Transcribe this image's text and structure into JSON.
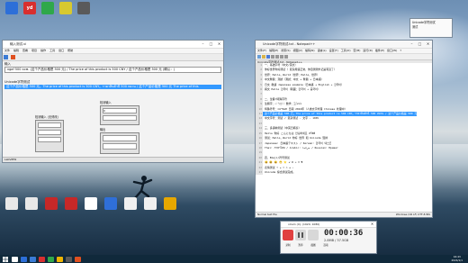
{
  "desktop": {
    "icons_top": [
      {
        "label": "",
        "color": "#2d6fd8"
      },
      {
        "label": "yd",
        "color": "#d82f2f"
      },
      {
        "label": "",
        "color": "#2fa84a"
      },
      {
        "label": "",
        "color": "#d8c92f"
      },
      {
        "label": "",
        "color": "#5a5a5a"
      }
    ],
    "icons_bottom": [
      {
        "label": "",
        "color": "#e8e8e8"
      },
      {
        "label": "",
        "color": "#e8e8e8"
      },
      {
        "label": "",
        "color": "#c62828"
      },
      {
        "label": "",
        "color": "#c62828"
      },
      {
        "label": "",
        "color": "#ffffff"
      },
      {
        "label": "",
        "color": "#2f6fd8"
      },
      {
        "label": "",
        "color": "#f0f0f0"
      },
      {
        "label": "",
        "color": "#f0f0f0"
      },
      {
        "label": "",
        "color": "#e6a700"
      }
    ],
    "notification": {
      "text": "Unicode字符测试\n测试"
    }
  },
  "win_left": {
    "title": "输入测试.vi",
    "menu": [
      "文件",
      "编辑",
      "查看",
      "项目",
      "操作",
      "工具",
      "窗口",
      "帮助"
    ],
    "line1": "输入",
    "line2": "xgaf 500 ксм. (这个产品价格是 500 元) / The price of this product is 500 CNY / 这个产品价格是 500 元 (确认：)",
    "label_unicode": "Unicode字符测试",
    "line3": "这个产品价格是 500 元。The price of this product is 500 CNY。ราคาสินค้านี้ 500 หยวน / 这个产品价格是 500 元 The price of this",
    "label_a": "检测输入 (无修改)",
    "label_b": "检测输入",
    "label_c": "输出",
    "status": "LabVIEW",
    "value_b": "0"
  },
  "win_right": {
    "title": "Unicode字符测试.txt - Notepad++",
    "menu": [
      "文件(F)",
      "编辑(E)",
      "搜索(S)",
      "视图(V)",
      "编码(N)",
      "语言(L)",
      "设置(T)",
      "工具(O)",
      "宏(M)",
      "运行(R)",
      "插件(P)",
      "窗口(W)",
      "?"
    ],
    "lines": [
      "一、基础字符（中文/英文）",
      "你好世界你好测试（ 复杂用语正常，你自测测外记是有没了）",
      "世界：Hello，World（世界：Hello，世界）",
      "中文繁體：測試（測試：中文 + 繁體 + 日本語）",
      "日文 敬語 Japanese example（日本語 + English + 한국어）",
      "韩文 Hello 한국어（韓國：한국어 + 중국어）",
      "",
      "二、生僻/特殊字符",
      "生僻字：𠀀𠀁𠀂𠀃 数学：∑∫∂√∞",
      "特殊符号：©®™€£¥ 日期 2024年（人类文字处理 Chinese 处理中）",
      "这个产品价格是 500 元。The price of this product is 500 CNY。ราคาสินค้านี้ 500 หยวน / 这个产品价格是 500 元",
      "中文字符：测试 / 复杂测试 · 文字 · 100%",
      "",
      "三、多语种测试（中英日韩泰）",
      "Hello 你好 こんにちは 안녕하세요 สวัสดี",
      "测试：Hello，World 你好 世界 和 Unicode 混排",
      "Japanese: 日本語テキスト / Korean: 한국어 텍스트",
      "Thai: ภาษาไทย / Arabic: مرحبا / Russian: Привет",
      "",
      "四、Emoji/符号测试",
      "😀 😃 😄 😁 ⭐ ✔ ✖ ➜ ☺ ♥",
      "表情测试 ☀ ☁ ☂ ☃ ★ ☆",
      "Unicode 综合测试完成。"
    ],
    "highlight_index": 10,
    "status_left": "Normal text file",
    "status_right": "Windows (CR LF)   UTF-8   INS"
  },
  "recorder": {
    "title": "oCam (0), (1920, 1080)",
    "time": "00:00:36",
    "size": "2.8MB / 37.5GB",
    "buttons": [
      "录制",
      "暂停",
      "截图",
      "选项"
    ]
  },
  "taskbar": {
    "time": "16:43",
    "date": "2024/1/1",
    "apps": [
      "#ffffff",
      "#2d6fd8",
      "#3a7bd5",
      "#d82f2f",
      "#2fa84a",
      "#f0b400",
      "#5a5a5a",
      "#e05020"
    ]
  }
}
